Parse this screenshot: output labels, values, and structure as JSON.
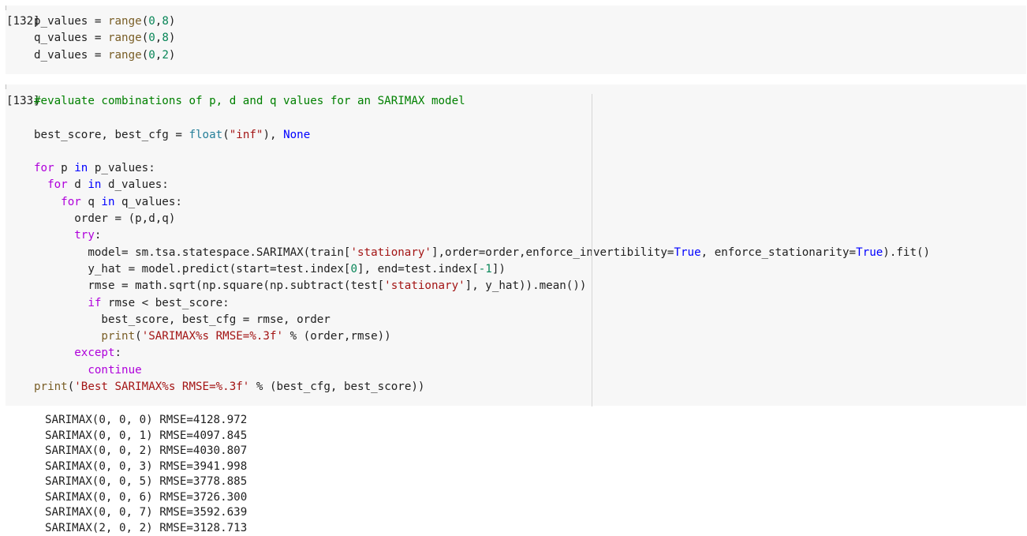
{
  "cells": [
    {
      "prompt": "[132]",
      "lines": [
        [
          {
            "t": "p_values = "
          },
          {
            "t": "range",
            "c": "fn"
          },
          {
            "t": "("
          },
          {
            "t": "0",
            "c": "n"
          },
          {
            "t": ","
          },
          {
            "t": "8",
            "c": "n"
          },
          {
            "t": ")"
          }
        ],
        [
          {
            "t": "q_values = "
          },
          {
            "t": "range",
            "c": "fn"
          },
          {
            "t": "("
          },
          {
            "t": "0",
            "c": "n"
          },
          {
            "t": ","
          },
          {
            "t": "8",
            "c": "n"
          },
          {
            "t": ")"
          }
        ],
        [
          {
            "t": "d_values = "
          },
          {
            "t": "range",
            "c": "fn"
          },
          {
            "t": "("
          },
          {
            "t": "0",
            "c": "n"
          },
          {
            "t": ","
          },
          {
            "t": "2",
            "c": "n"
          },
          {
            "t": ")"
          }
        ]
      ]
    },
    {
      "prompt": "[133]",
      "lines": [
        [
          {
            "t": "#evaluate combinations of p, d and q values for an SARIMAX model",
            "c": "c"
          }
        ],
        [],
        [
          {
            "t": "best_score, best_cfg = "
          },
          {
            "t": "float",
            "c": "b"
          },
          {
            "t": "("
          },
          {
            "t": "\"inf\"",
            "c": "s"
          },
          {
            "t": "), "
          },
          {
            "t": "None",
            "c": "k"
          }
        ],
        [],
        [
          {
            "t": "for",
            "c": "kw"
          },
          {
            "t": " p "
          },
          {
            "t": "in",
            "c": "k"
          },
          {
            "t": " p_values:"
          }
        ],
        [
          {
            "t": "  "
          },
          {
            "t": "for",
            "c": "kw"
          },
          {
            "t": " d "
          },
          {
            "t": "in",
            "c": "k"
          },
          {
            "t": " d_values:"
          }
        ],
        [
          {
            "t": "    "
          },
          {
            "t": "for",
            "c": "kw"
          },
          {
            "t": " q "
          },
          {
            "t": "in",
            "c": "k"
          },
          {
            "t": " q_values:"
          }
        ],
        [
          {
            "t": "      order = (p,d,q)"
          }
        ],
        [
          {
            "t": "      "
          },
          {
            "t": "try",
            "c": "kw"
          },
          {
            "t": ":"
          }
        ],
        [
          {
            "t": "        model= sm.tsa.statespace.SARIMAX(train["
          },
          {
            "t": "'stationary'",
            "c": "s"
          },
          {
            "t": "],order=order,enforce_invertibility="
          },
          {
            "t": "True",
            "c": "t"
          },
          {
            "t": ", enforce_stationarity="
          },
          {
            "t": "True",
            "c": "t"
          },
          {
            "t": ").fit()"
          }
        ],
        [
          {
            "t": "        y_hat = model.predict(start=test.index["
          },
          {
            "t": "0",
            "c": "n"
          },
          {
            "t": "], end=test.index["
          },
          {
            "t": "-1",
            "c": "n"
          },
          {
            "t": "])"
          }
        ],
        [
          {
            "t": "        rmse = math.sqrt(np.square(np.subtract(test["
          },
          {
            "t": "'stationary'",
            "c": "s"
          },
          {
            "t": "], y_hat)).mean())"
          }
        ],
        [
          {
            "t": "        "
          },
          {
            "t": "if",
            "c": "kw"
          },
          {
            "t": " rmse < best_score:"
          }
        ],
        [
          {
            "t": "          best_score, best_cfg = rmse, order"
          }
        ],
        [
          {
            "t": "          "
          },
          {
            "t": "print",
            "c": "fn"
          },
          {
            "t": "("
          },
          {
            "t": "'SARIMAX%s RMSE=%.3f'",
            "c": "s"
          },
          {
            "t": " % (order,rmse))"
          }
        ],
        [
          {
            "t": "      "
          },
          {
            "t": "except",
            "c": "kw"
          },
          {
            "t": ":"
          }
        ],
        [
          {
            "t": "        "
          },
          {
            "t": "continue",
            "c": "kw"
          }
        ],
        [
          {
            "t": "print",
            "c": "fn"
          },
          {
            "t": "("
          },
          {
            "t": "'Best SARIMAX%s RMSE=%.3f'",
            "c": "s"
          },
          {
            "t": " % (best_cfg, best_score))"
          }
        ]
      ]
    }
  ],
  "output": [
    "SARIMAX(0, 0, 0) RMSE=4128.972",
    "SARIMAX(0, 0, 1) RMSE=4097.845",
    "SARIMAX(0, 0, 2) RMSE=4030.807",
    "SARIMAX(0, 0, 3) RMSE=3941.998",
    "SARIMAX(0, 0, 5) RMSE=3778.885",
    "SARIMAX(0, 0, 6) RMSE=3726.300",
    "SARIMAX(0, 0, 7) RMSE=3592.639",
    "SARIMAX(2, 0, 2) RMSE=3128.713"
  ]
}
